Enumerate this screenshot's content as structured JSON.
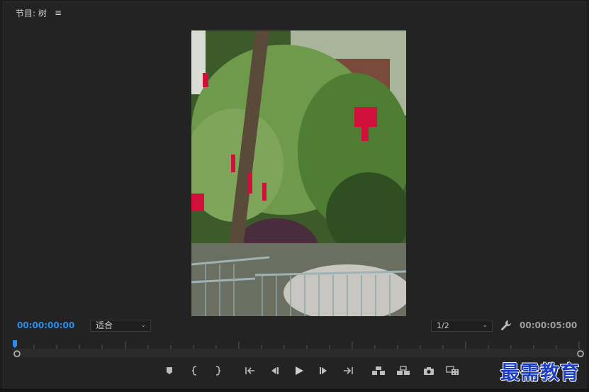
{
  "panel": {
    "title": "节目: 树",
    "menu_icon": "hamburger-icon"
  },
  "playback": {
    "current_timecode": "00:00:00:00",
    "duration_timecode": "00:00:05:00",
    "zoom": "适合",
    "resolution": "1/2"
  },
  "video": {
    "description_icon": "video-frame"
  },
  "controls": [
    {
      "name": "add-marker-button",
      "icon": "marker-icon"
    },
    {
      "name": "mark-in-button",
      "icon": "mark-in-icon"
    },
    {
      "name": "mark-out-button",
      "icon": "mark-out-icon"
    },
    {
      "name": "go-to-in-button",
      "icon": "go-to-in-icon"
    },
    {
      "name": "step-back-button",
      "icon": "step-back-icon"
    },
    {
      "name": "play-button",
      "icon": "play-icon"
    },
    {
      "name": "step-forward-button",
      "icon": "step-forward-icon"
    },
    {
      "name": "go-to-out-button",
      "icon": "go-to-out-icon"
    },
    {
      "name": "lift-button",
      "icon": "lift-icon"
    },
    {
      "name": "extract-button",
      "icon": "extract-icon"
    },
    {
      "name": "export-frame-button",
      "icon": "camera-icon"
    },
    {
      "name": "compare-view-button",
      "icon": "compare-icon"
    }
  ],
  "watermark": "最需教育",
  "colors": {
    "accent_timecode": "#2d8ceb",
    "panel_bg": "#232323"
  }
}
